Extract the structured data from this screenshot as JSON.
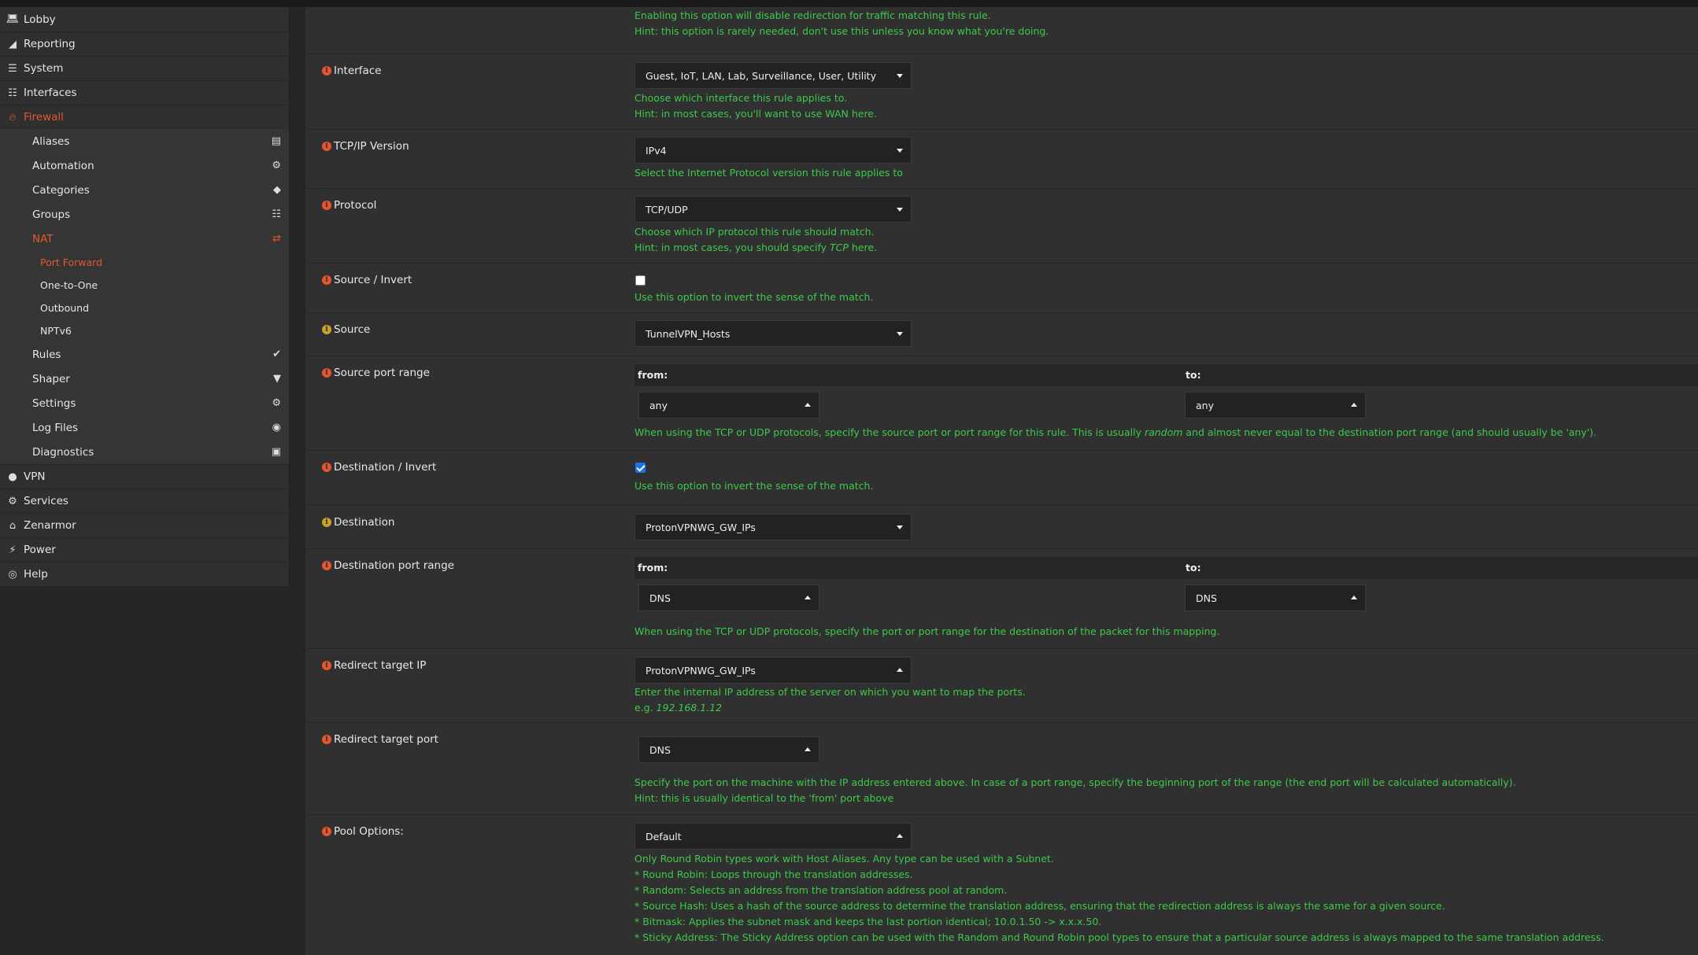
{
  "sidebar": {
    "top_items": [
      {
        "label": "Lobby",
        "icon": "laptop-icon"
      },
      {
        "label": "Reporting",
        "icon": "chart-icon"
      },
      {
        "label": "System",
        "icon": "server-icon"
      },
      {
        "label": "Interfaces",
        "icon": "network-icon"
      },
      {
        "label": "Firewall",
        "icon": "fire-icon"
      }
    ],
    "firewall_items": [
      {
        "label": "Aliases",
        "icon": "list-icon"
      },
      {
        "label": "Automation",
        "icon": "gear-icon"
      },
      {
        "label": "Categories",
        "icon": "tags-icon"
      },
      {
        "label": "Groups",
        "icon": "sitemap-icon"
      },
      {
        "label": "NAT",
        "icon": "exchange-icon"
      }
    ],
    "nat_items": [
      {
        "label": "Port Forward"
      },
      {
        "label": "One-to-One"
      },
      {
        "label": "Outbound"
      },
      {
        "label": "NPTv6"
      }
    ],
    "firewall_items_2": [
      {
        "label": "Rules",
        "icon": "check-icon"
      },
      {
        "label": "Shaper",
        "icon": "filter-icon"
      },
      {
        "label": "Settings",
        "icon": "cogs-icon"
      },
      {
        "label": "Log Files",
        "icon": "eye-icon"
      },
      {
        "label": "Diagnostics",
        "icon": "medkit-icon"
      }
    ],
    "bottom_items": [
      {
        "label": "VPN",
        "icon": "globe-icon"
      },
      {
        "label": "Services",
        "icon": "cog-icon"
      },
      {
        "label": "Zenarmor",
        "icon": "zenarmor-icon"
      },
      {
        "label": "Power",
        "icon": "plug-icon"
      },
      {
        "label": "Help",
        "icon": "lifebuoy-icon"
      }
    ]
  },
  "form": {
    "no_rdr_hint1": "Enabling this option will disable redirection for traffic matching this rule.",
    "no_rdr_hint2": "Hint: this option is rarely needed, don't use this unless you know what you're doing.",
    "interface": {
      "label": "Interface",
      "value": "Guest, IoT, LAN, Lab, Surveillance, User, Utility",
      "hint1": "Choose which interface this rule applies to.",
      "hint2": "Hint: in most cases, you'll want to use WAN here."
    },
    "ipversion": {
      "label": "TCP/IP Version",
      "value": "IPv4",
      "hint1": "Select the Internet Protocol version this rule applies to"
    },
    "protocol": {
      "label": "Protocol",
      "value": "TCP/UDP",
      "hint1": "Choose which IP protocol this rule should match.",
      "hint2_pre": "Hint: in most cases, you should specify ",
      "hint2_em": "TCP",
      "hint2_post": " here."
    },
    "source_invert": {
      "label": "Source / Invert",
      "checked": false,
      "hint1": "Use this option to invert the sense of the match."
    },
    "source": {
      "label": "Source",
      "value": "TunnelVPN_Hosts"
    },
    "source_port": {
      "label": "Source port range",
      "from_label": "from:",
      "to_label": "to:",
      "from_value": "any",
      "to_value": "any",
      "hint_pre": "When using the TCP or UDP protocols, specify the source port or port range for this rule. ",
      "hint_b1": "This is usually ",
      "hint_em": "random",
      "hint_b2": " and almost never equal to the destination port range (and should usually be 'any')."
    },
    "dest_invert": {
      "label": "Destination / Invert",
      "checked": true,
      "hint1": "Use this option to invert the sense of the match."
    },
    "destination": {
      "label": "Destination",
      "value": "ProtonVPNWG_GW_IPs"
    },
    "dest_port": {
      "label": "Destination port range",
      "from_label": "from:",
      "to_label": "to:",
      "from_value": "DNS",
      "to_value": "DNS",
      "hint1": "When using the TCP or UDP protocols, specify the port or port range for the destination of the packet for this mapping."
    },
    "redirect_ip": {
      "label": "Redirect target IP",
      "value": "ProtonVPNWG_GW_IPs",
      "hint1": "Enter the internal IP address of the server on which you want to map the ports.",
      "hint2_pre": "e.g. ",
      "hint2_em": "192.168.1.12"
    },
    "redirect_port": {
      "label": "Redirect target port",
      "value": "DNS",
      "hint1": "Specify the port on the machine with the IP address entered above. In case of a port range, specify the beginning port of the range (the end port will be calculated automatically).",
      "hint2": "Hint: this is usually identical to the 'from' port above"
    },
    "pool": {
      "label": "Pool Options:",
      "value": "Default",
      "hints": [
        "Only Round Robin types work with Host Aliases. Any type can be used with a Subnet.",
        "* Round Robin: Loops through the translation addresses.",
        "* Random: Selects an address from the translation address pool at random.",
        "* Source Hash: Uses a hash of the source address to determine the translation address, ensuring that the redirection address is always the same for a given source.",
        "* Bitmask: Applies the subnet mask and keeps the last portion identical; 10.0.1.50 -> x.x.x.50.",
        "* Sticky Address: The Sticky Address option can be used with the Random and Round Robin pool types to ensure that a particular source address is always mapped to the same translation address."
      ]
    }
  },
  "colors": {
    "accent": "#e4572e",
    "hint_green": "#3ec94a"
  }
}
